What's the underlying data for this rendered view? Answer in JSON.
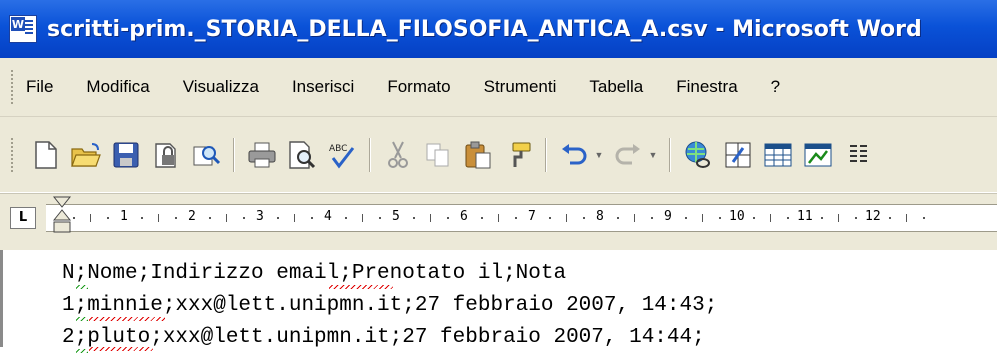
{
  "window": {
    "title": "scritti-prim._STORIA_DELLA_FILOSOFIA_ANTICA_A.csv - Microsoft Word",
    "app_icon": "word-document-icon"
  },
  "menu": {
    "items": [
      {
        "label": "File"
      },
      {
        "label": "Modifica"
      },
      {
        "label": "Visualizza"
      },
      {
        "label": "Inserisci"
      },
      {
        "label": "Formato"
      },
      {
        "label": "Strumenti"
      },
      {
        "label": "Tabella"
      },
      {
        "label": "Finestra"
      },
      {
        "label": "?"
      }
    ]
  },
  "toolbar": {
    "buttons": [
      "new-document-icon",
      "open-folder-icon",
      "save-icon",
      "permission-icon",
      "research-icon",
      "print-icon",
      "print-preview-icon",
      "spelling-icon",
      "cut-icon",
      "copy-icon",
      "paste-icon",
      "format-painter-icon",
      "undo-icon",
      "redo-icon",
      "hyperlink-icon",
      "tables-borders-icon",
      "insert-table-icon",
      "insert-excel-icon",
      "columns-icon"
    ]
  },
  "ruler": {
    "tab_selector": "L",
    "numbers": [
      "1",
      "2",
      "3",
      "4",
      "5",
      "6",
      "7",
      "8",
      "9",
      "10",
      "11",
      "12"
    ]
  },
  "document": {
    "lines": [
      "N;Nome;Indirizzo email;Prenotato il;Nota",
      "1;minnie;xxx@lett.unipmn.it;27 febbraio 2007, 14:43;",
      "2;pluto;xxx@lett.unipmn.it;27 febbraio 2007, 14:44;"
    ]
  },
  "colors": {
    "titlebar": "#0a52d8",
    "chrome": "#ece9d8",
    "spell_error": "#e00000",
    "grammar_error": "#1a9a1a"
  }
}
